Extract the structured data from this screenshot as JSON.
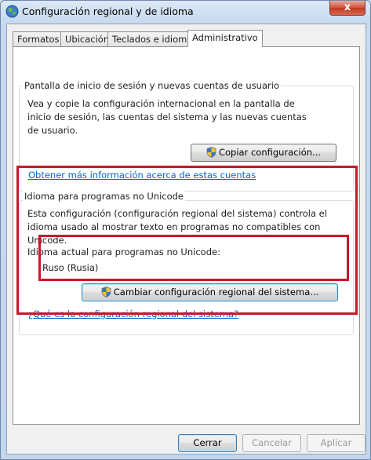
{
  "window": {
    "title": "Configuración regional y de idioma",
    "close_label": "x",
    "icon": "globe-icon"
  },
  "tabs": [
    {
      "label": "Formatos",
      "active": false
    },
    {
      "label": "Ubicación",
      "active": false
    },
    {
      "label": "Teclados e idiomas",
      "active": false
    },
    {
      "label": "Administrativo",
      "active": true
    }
  ],
  "welcome_group": {
    "legend": "Pantalla de inicio de sesión y nuevas cuentas de usuario",
    "description": "Vea y copie la configuración internacional en la pantalla de inicio de sesión, las cuentas del sistema y las nuevas cuentas de usuario.",
    "copy_button": "Copiar configuración...",
    "link": "Obtener más información acerca de estas cuentas"
  },
  "unicode_group": {
    "legend": "Idioma para programas no Unicode",
    "description": "Esta configuración (configuración regional del sistema) controla el idioma usado al mostrar texto en programas no compatibles con Unicode.",
    "current_label": "Idioma actual para programas no Unicode:",
    "current_value": "Ruso (Rusia)",
    "change_button": "Cambiar configuración regional del sistema...",
    "link": "¿Qué es la configuración regional del sistema?"
  },
  "footer": {
    "ok": "Cerrar",
    "cancel": "Cancelar",
    "apply": "Aplicar"
  },
  "colors": {
    "highlight": "#c8182a",
    "link": "#0066cc"
  }
}
